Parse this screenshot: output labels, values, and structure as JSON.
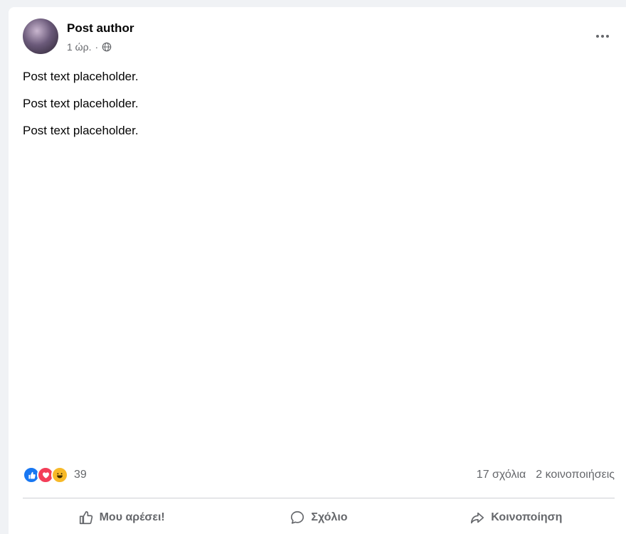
{
  "post": {
    "author": "Post author",
    "time": "1 ώρ.",
    "privacy_icon": "globe-icon",
    "paragraphs": [
      "Post text placeholder.",
      "Post text placeholder.",
      "Post text placeholder."
    ]
  },
  "stats": {
    "reaction_icons": [
      "like-reaction-icon",
      "love-reaction-icon",
      "haha-reaction-icon"
    ],
    "reaction_count": "39",
    "comments": "17 σχόλια",
    "shares": "2 κοινοποιήσεις"
  },
  "actions": {
    "like_label": "Μου αρέσει!",
    "comment_label": "Σχόλιο",
    "share_label": "Κοινοποίηση"
  },
  "colors": {
    "like": "#1877f2",
    "love": "#f33e58",
    "haha": "#f7b928",
    "secondary_text": "#65676b"
  }
}
